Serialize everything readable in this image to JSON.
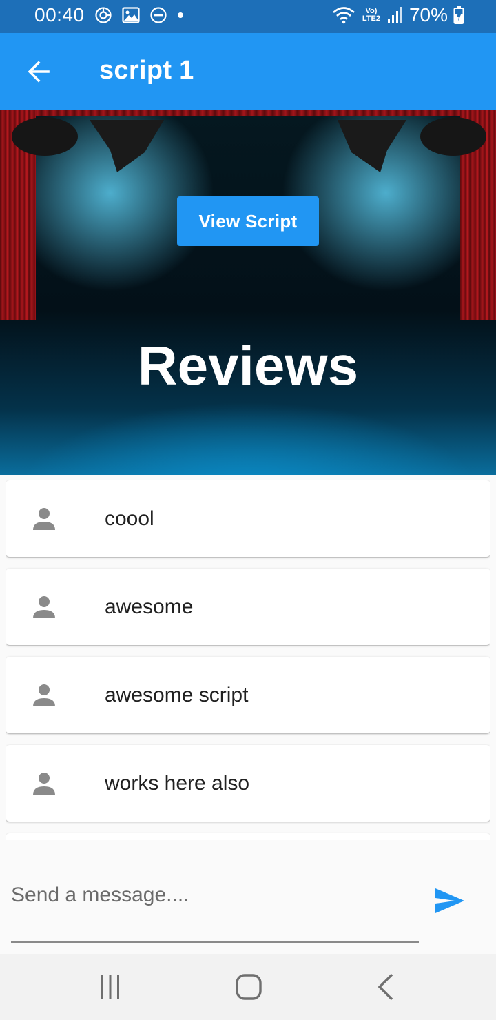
{
  "status_bar": {
    "time": "00:40",
    "network_label": "Vo) LTE2",
    "battery": "70%"
  },
  "app_bar": {
    "title": "script 1",
    "back_icon": "arrow-back-icon"
  },
  "hero": {
    "view_script_label": "View Script",
    "section_title": "Reviews"
  },
  "reviews": [
    {
      "text": "coool",
      "icon": "person-icon"
    },
    {
      "text": "awesome",
      "icon": "person-icon"
    },
    {
      "text": "awesome script",
      "icon": "person-icon"
    },
    {
      "text": "works here also",
      "icon": "person-icon"
    }
  ],
  "composer": {
    "placeholder": "Send a message....",
    "value": "",
    "send_icon": "send-icon"
  },
  "nav_bar": {
    "items": [
      "recents-icon",
      "home-icon",
      "back-icon"
    ]
  },
  "colors": {
    "primary": "#2196f3",
    "status_bar": "#1d6fb8",
    "text": "#212121",
    "icon_gray": "#8a8a8a"
  }
}
